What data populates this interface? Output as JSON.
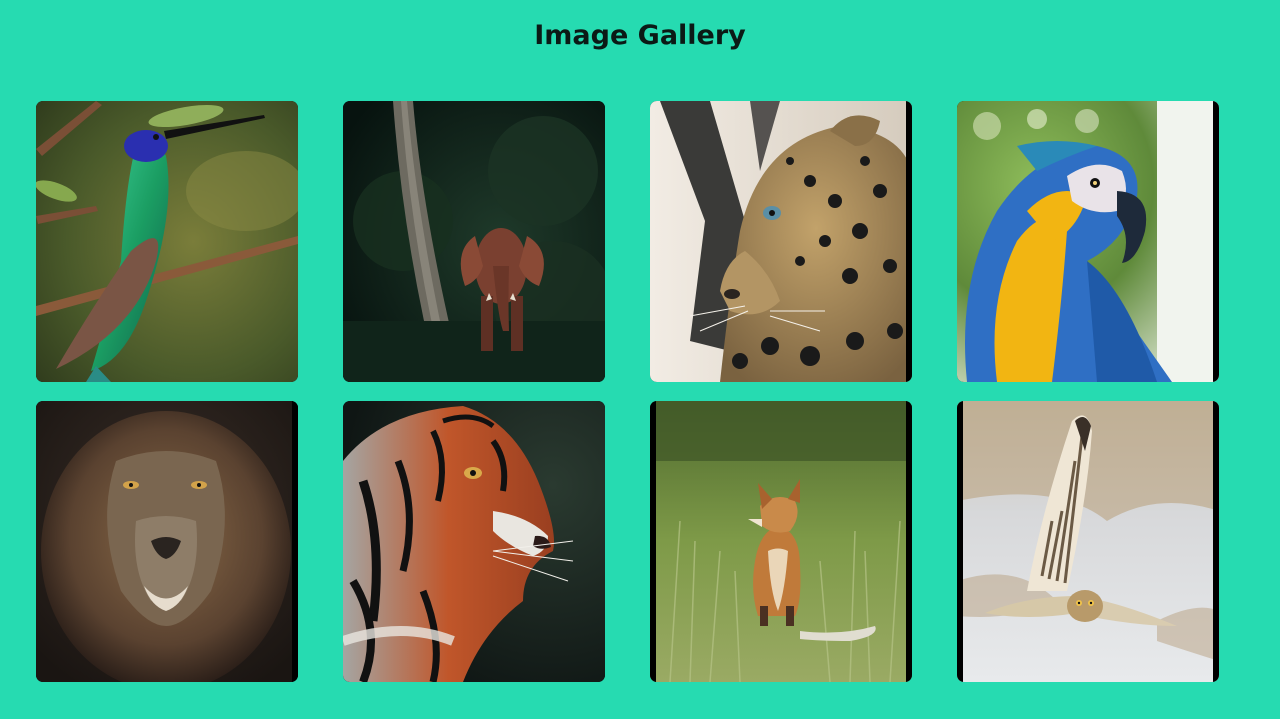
{
  "page": {
    "title": "Image Gallery",
    "background": "#26dbb1"
  },
  "gallery": {
    "images": [
      {
        "subject": "hummingbird",
        "palette": [
          "#3d5a2a",
          "#1fa86b",
          "#2b2fa8"
        ]
      },
      {
        "subject": "elephant",
        "palette": [
          "#0d1f1a",
          "#22402e",
          "#8a4a36"
        ]
      },
      {
        "subject": "leopard",
        "palette": [
          "#e7dfd3",
          "#a88b5a",
          "#1a1a1a"
        ]
      },
      {
        "subject": "macaw",
        "palette": [
          "#6fa04a",
          "#f2b512",
          "#2f6fc4"
        ]
      },
      {
        "subject": "lion",
        "palette": [
          "#1f1815",
          "#6b4a2e",
          "#d8c6a8"
        ]
      },
      {
        "subject": "tiger",
        "palette": [
          "#16201c",
          "#c0562a",
          "#e9e6e0"
        ]
      },
      {
        "subject": "fox",
        "palette": [
          "#6e8a3c",
          "#c07a3a",
          "#9cab66"
        ]
      },
      {
        "subject": "owl",
        "palette": [
          "#d9dadc",
          "#b69a70",
          "#6b5f52"
        ]
      }
    ]
  }
}
